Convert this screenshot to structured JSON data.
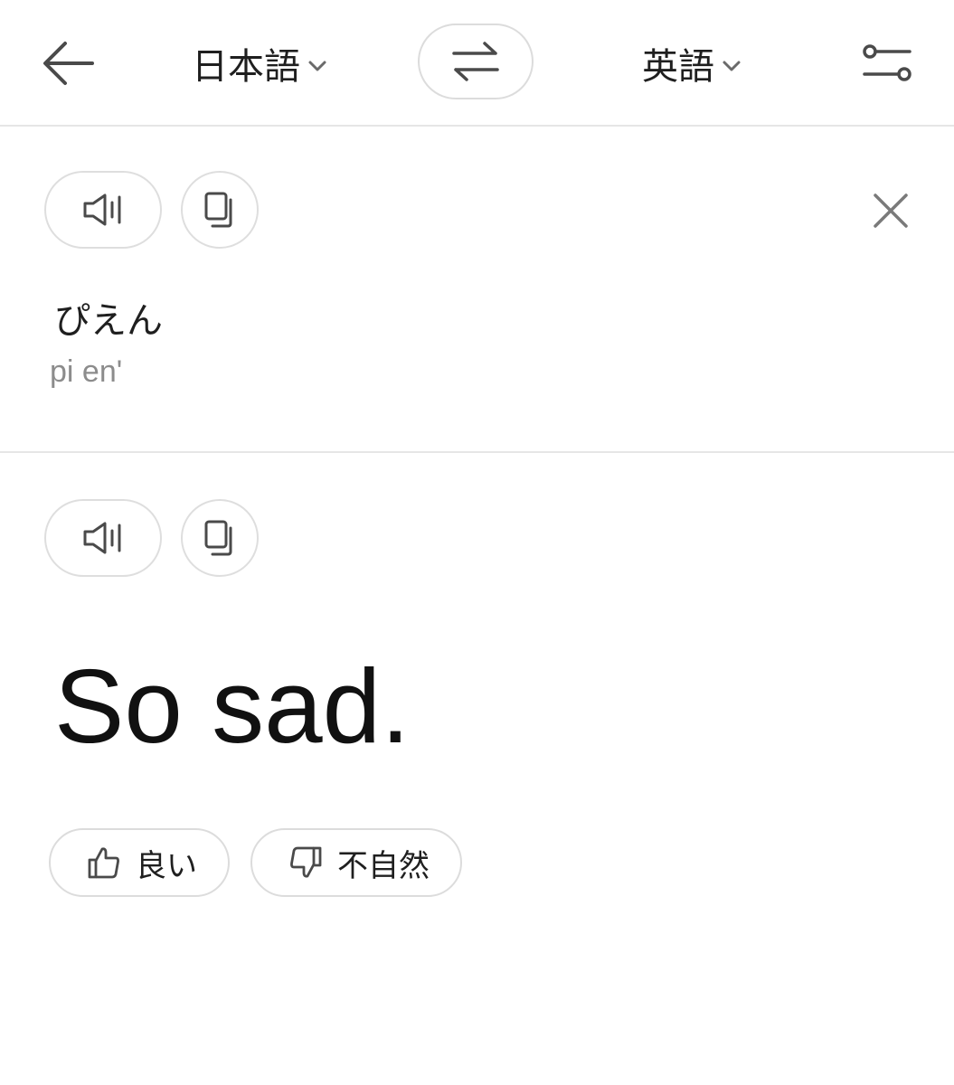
{
  "header": {
    "source_language": "日本語",
    "target_language": "英語"
  },
  "source": {
    "text": "ぴえん",
    "romanization": "pi en'"
  },
  "result": {
    "text": "So sad."
  },
  "feedback": {
    "good_label": "良い",
    "unnatural_label": "不自然"
  },
  "icons": {
    "back": "back-arrow-icon",
    "chevron": "chevron-down-icon",
    "swap": "swap-icon",
    "settings": "sliders-icon",
    "speaker": "speaker-icon",
    "copy": "copy-icon",
    "close": "close-icon",
    "thumbs_up": "thumbs-up-icon",
    "thumbs_down": "thumbs-down-icon"
  },
  "colors": {
    "icon": "#4a4a4a",
    "border": "#dcdcdc",
    "muted_text": "#8c8c8c"
  }
}
